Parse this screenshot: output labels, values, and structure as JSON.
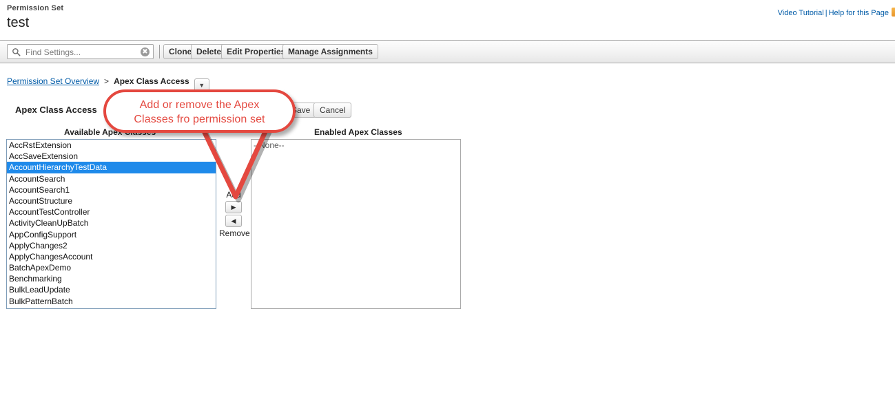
{
  "header": {
    "eyebrow": "Permission Set",
    "title": "test",
    "links": {
      "video_tutorial": "Video Tutorial",
      "separator": "|",
      "help_for_this_page": "Help for this Page",
      "help_badge_icon": "help-badge-icon"
    }
  },
  "toolbar": {
    "search": {
      "icon": "search-icon",
      "value": "",
      "placeholder": "Find Settings...",
      "clear_icon": "✖"
    },
    "buttons": [
      {
        "label": "Clone"
      },
      {
        "label": "Delete"
      },
      {
        "label": "Edit Properties"
      },
      {
        "label": "Manage Assignments"
      }
    ]
  },
  "breadcrumb": {
    "parent": "Permission Set Overview",
    "separator": ">",
    "current": "Apex Class Access",
    "dropdown_icon": "▼"
  },
  "section": {
    "title": "Apex Class Access",
    "save_label": "Save",
    "cancel_label": "Cancel"
  },
  "dual_list": {
    "available_label": "Available Apex Classes",
    "enabled_label": "Enabled Apex Classes",
    "available_options": [
      "AccRstExtension",
      "AccSaveExtension",
      "AccountHierarchyTestData",
      "AccountSearch",
      "AccountSearch1",
      "AccountStructure",
      "AccountTestController",
      "ActivityCleanUpBatch",
      "AppConfigSupport",
      "ApplyChanges2",
      "ApplyChangesAccount",
      "BatchApexDemo",
      "Benchmarking",
      "BulkLeadUpdate",
      "BulkPatternBatch"
    ],
    "selected_option": "AccountHierarchyTestData",
    "enabled_options_empty_text": "--None--",
    "add_label": "Add",
    "remove_label": "Remove",
    "add_icon": "▶",
    "remove_icon": "◀"
  },
  "callout": {
    "line1": "Add or remove the Apex",
    "line2": "Classes fro permission set"
  },
  "colors": {
    "accent_link": "#015ba7",
    "selection_blue": "#1f8aea",
    "callout_red": "#e4483f",
    "listbox_border_focus": "#7f9db9",
    "listbox_border": "#a8a8a8"
  }
}
